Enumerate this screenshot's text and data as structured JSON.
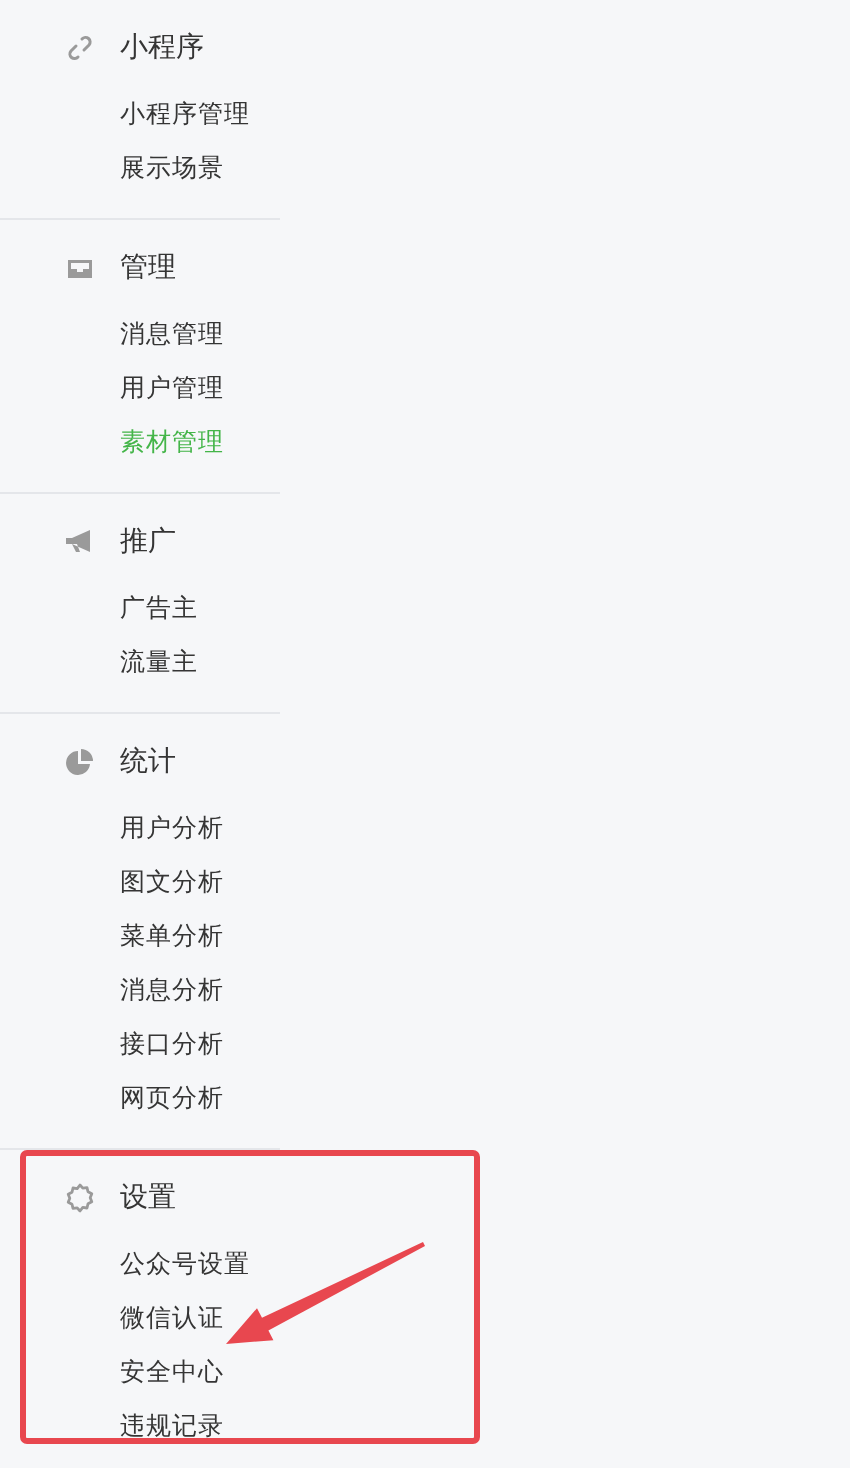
{
  "sidebar": {
    "sections": [
      {
        "title": "小程序",
        "items": [
          {
            "label": "小程序管理",
            "selected": false
          },
          {
            "label": "展示场景",
            "selected": false
          }
        ]
      },
      {
        "title": "管理",
        "items": [
          {
            "label": "消息管理",
            "selected": false
          },
          {
            "label": "用户管理",
            "selected": false
          },
          {
            "label": "素材管理",
            "selected": true
          }
        ]
      },
      {
        "title": "推广",
        "items": [
          {
            "label": "广告主",
            "selected": false
          },
          {
            "label": "流量主",
            "selected": false
          }
        ]
      },
      {
        "title": "统计",
        "items": [
          {
            "label": "用户分析",
            "selected": false
          },
          {
            "label": "图文分析",
            "selected": false
          },
          {
            "label": "菜单分析",
            "selected": false
          },
          {
            "label": "消息分析",
            "selected": false
          },
          {
            "label": "接口分析",
            "selected": false
          },
          {
            "label": "网页分析",
            "selected": false
          }
        ]
      },
      {
        "title": "设置",
        "items": [
          {
            "label": "公众号设置",
            "selected": false
          },
          {
            "label": "微信认证",
            "selected": false
          },
          {
            "label": "安全中心",
            "selected": false
          },
          {
            "label": "违规记录",
            "selected": false
          }
        ]
      }
    ]
  }
}
